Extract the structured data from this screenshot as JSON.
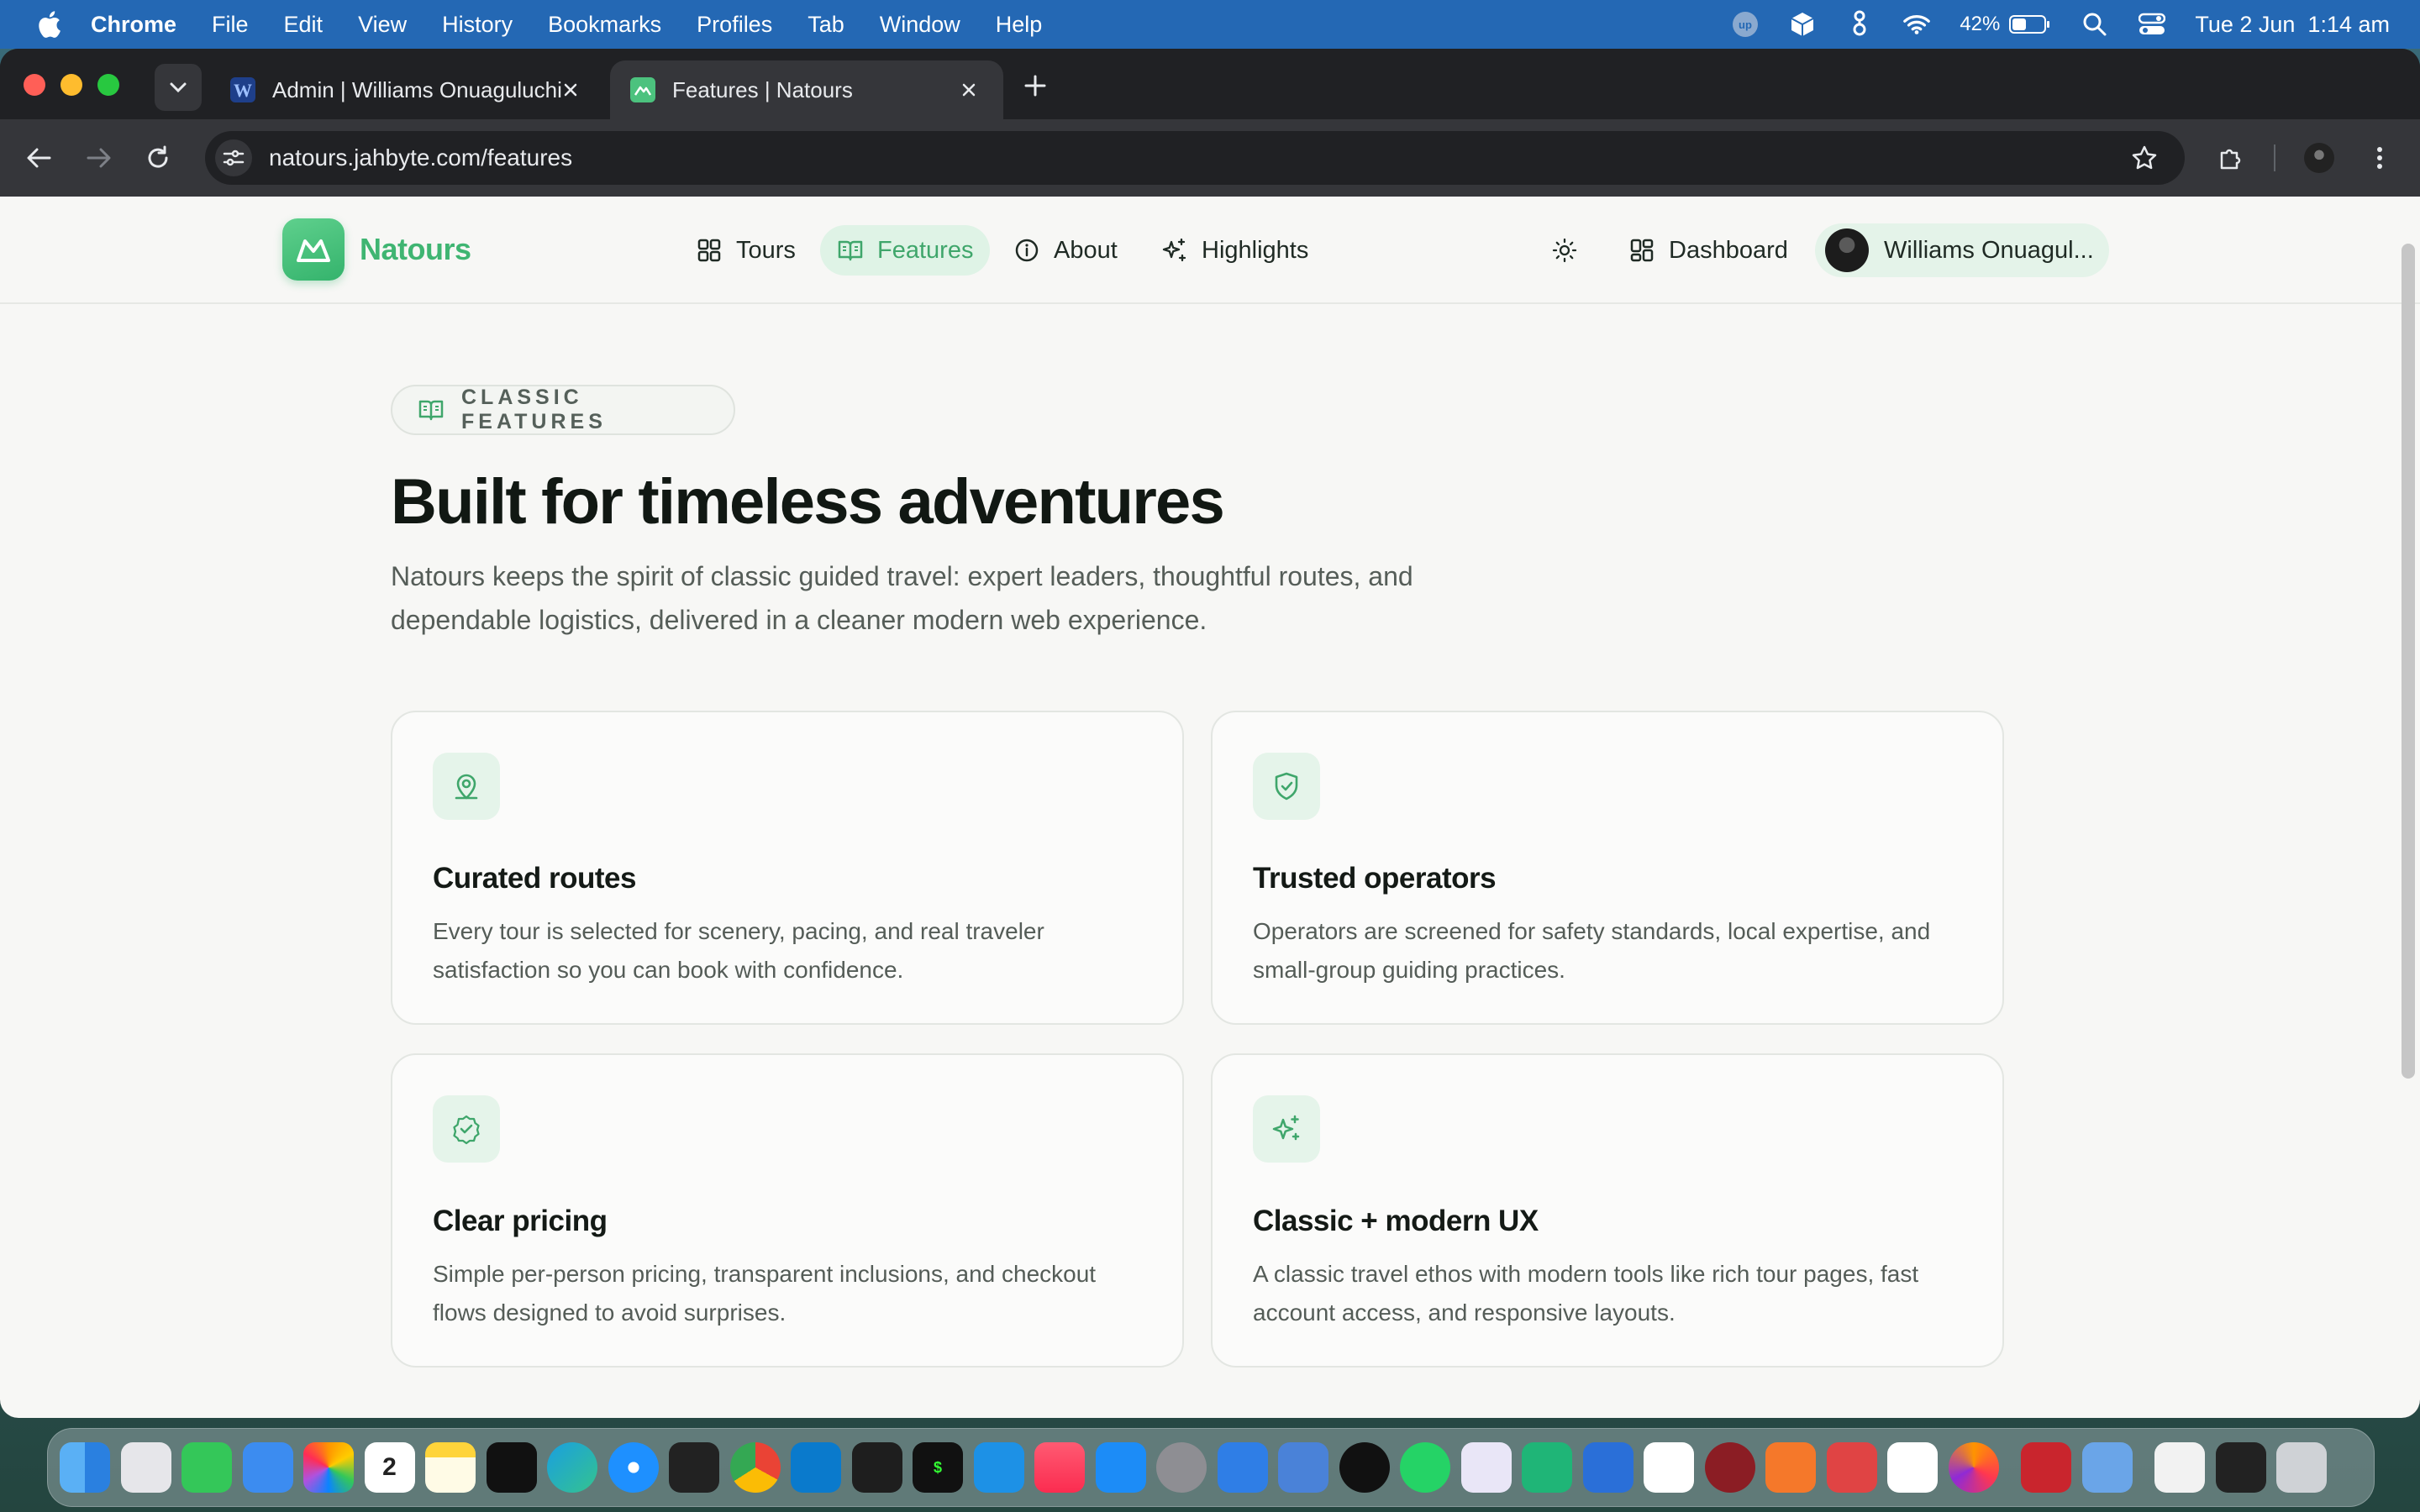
{
  "menubar": {
    "app": "Chrome",
    "items": [
      "File",
      "Edit",
      "View",
      "History",
      "Bookmarks",
      "Profiles",
      "Tab",
      "Window",
      "Help"
    ],
    "battery": "42%",
    "datetime": "Tue 2 Jun  1:14 am"
  },
  "browser": {
    "tabs": [
      {
        "title": "Admin | Williams Onuaguluchi",
        "active": false
      },
      {
        "title": "Features | Natours",
        "active": true
      }
    ],
    "url": "natours.jahbyte.com/features"
  },
  "site": {
    "brand": "Natours",
    "nav": [
      {
        "label": "Tours",
        "icon": "grid-icon"
      },
      {
        "label": "Features",
        "icon": "book-open-icon",
        "active": true
      },
      {
        "label": "About",
        "icon": "info-icon"
      },
      {
        "label": "Highlights",
        "icon": "sparkles-icon"
      }
    ],
    "dashboard_label": "Dashboard",
    "user_name": "Williams Onuagul..."
  },
  "hero": {
    "badge": "CLASSIC FEATURES",
    "title": "Built for timeless adventures",
    "subtitle": "Natours keeps the spirit of classic guided travel: expert leaders, thoughtful routes, and dependable logistics, delivered in a cleaner modern web experience."
  },
  "features": [
    {
      "icon": "map-pin-icon",
      "title": "Curated routes",
      "desc": "Every tour is selected for scenery, pacing, and real traveler satisfaction so you can book with confidence."
    },
    {
      "icon": "shield-check-icon",
      "title": "Trusted operators",
      "desc": "Operators are screened for safety standards, local expertise, and small-group guiding practices."
    },
    {
      "icon": "badge-check-icon",
      "title": "Clear pricing",
      "desc": "Simple per-person pricing, transparent inclusions, and checkout flows designed to avoid surprises."
    },
    {
      "icon": "sparkles-icon",
      "title": "Classic + modern UX",
      "desc": "A classic travel ethos with modern tools like rich tour pages, fast account access, and responsive layouts."
    }
  ],
  "colors": {
    "accent": "#3fb572",
    "accent_bg": "#dff3e6",
    "page_bg": "#f7f7f5",
    "menubar": "#2468b4"
  },
  "dock": {
    "date_label": "2",
    "apps": [
      "finder-icon",
      "launchpad-icon",
      "messages-icon",
      "mail-icon",
      "photos-icon",
      "calendar-icon",
      "notes-icon",
      "appletv-icon",
      "edge-icon",
      "safari-icon",
      "cursor-icon",
      "chrome-icon",
      "vscode-icon",
      "figma-icon",
      "terminal-icon",
      "docker-icon",
      "music-icon",
      "appstore-icon",
      "settings-icon",
      "files-icon",
      "simulator-icon",
      "upwork-icon",
      "whatsapp-icon",
      "proton-icon",
      "chatgpt-icon",
      "xcode-icon",
      "mongodb-icon",
      "git-icon",
      "pen-icon",
      "archive-icon",
      "sheet-icon",
      "firefox-icon",
      "dictionary-icon",
      "finder-disk-icon",
      "document-icon",
      "screen-icon",
      "trash-icon"
    ]
  }
}
